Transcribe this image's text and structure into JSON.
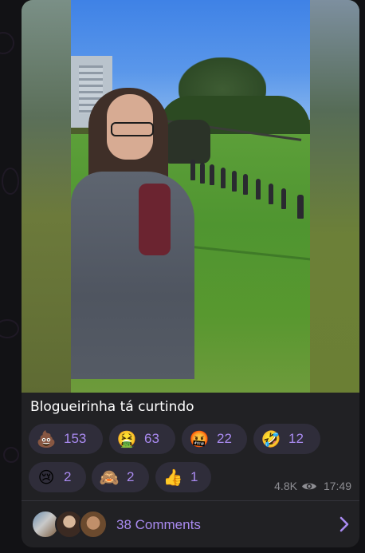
{
  "post": {
    "caption": "Blogueirinha tá curtindo",
    "views": "4.8K",
    "time": "17:49"
  },
  "reactions": [
    {
      "icon": "poop-emoji",
      "glyph": "💩",
      "count": "153"
    },
    {
      "icon": "vomiting-face-emoji",
      "glyph": "🤮",
      "count": "63"
    },
    {
      "icon": "cursing-face-emoji",
      "glyph": "🤬",
      "count": "22"
    },
    {
      "icon": "rolling-laughing-emoji",
      "glyph": "🤣",
      "count": "12"
    },
    {
      "icon": "crying-face-emoji",
      "glyph": "😢",
      "count": "2"
    },
    {
      "icon": "see-no-evil-monkey-emoji",
      "glyph": "🙈",
      "count": "2"
    },
    {
      "icon": "thumbs-up-emoji",
      "glyph": "👍",
      "count": "1"
    }
  ],
  "comments": {
    "label": "38 Comments"
  },
  "colors": {
    "accent": "#a98af0",
    "card_bg": "#212124",
    "reaction_bg": "#2f2d3a",
    "meta_text": "#8e8e93"
  }
}
